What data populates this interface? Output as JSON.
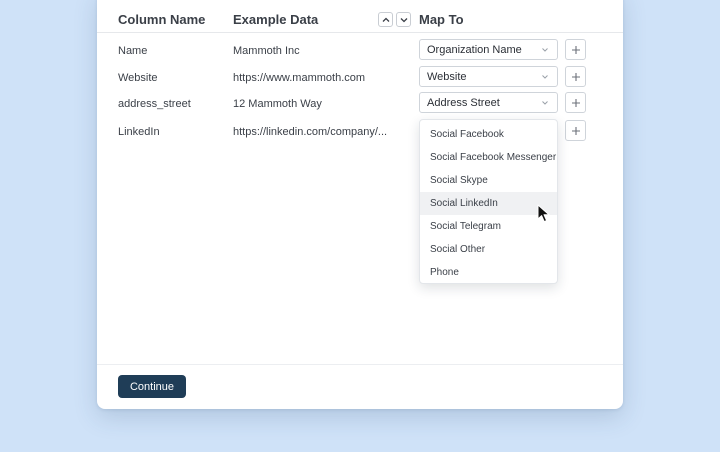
{
  "header": {
    "column_name": "Column Name",
    "example_data": "Example Data",
    "map_to": "Map To"
  },
  "rows": [
    {
      "column": "Name",
      "example": "Mammoth Inc",
      "map_to": "Organization Name"
    },
    {
      "column": "Website",
      "example": "https://www.mammoth.com",
      "map_to": "Website"
    },
    {
      "column": "address_street",
      "example": "12 Mammoth Way",
      "map_to": "Address Street"
    },
    {
      "column": "LinkedIn",
      "example": "https://linkedin.com/company/...",
      "map_to": ""
    }
  ],
  "dropdown": {
    "options": [
      "Social Facebook",
      "Social Facebook Messenger",
      "Social Skype",
      "Social LinkedIn",
      "Social Telegram",
      "Social Other",
      "Phone"
    ],
    "hovered": "Social LinkedIn"
  },
  "footer": {
    "continue_label": "Continue"
  },
  "colors": {
    "background": "#cfe2f8",
    "primary_button": "#1f3d57",
    "hover_option": "#f0f1f3"
  },
  "icons": {
    "sort_up": "chevron-up-icon",
    "sort_down": "chevron-down-icon",
    "select_chevron": "chevron-down-icon",
    "add": "plus-icon",
    "cursor": "mouse-pointer-icon"
  }
}
